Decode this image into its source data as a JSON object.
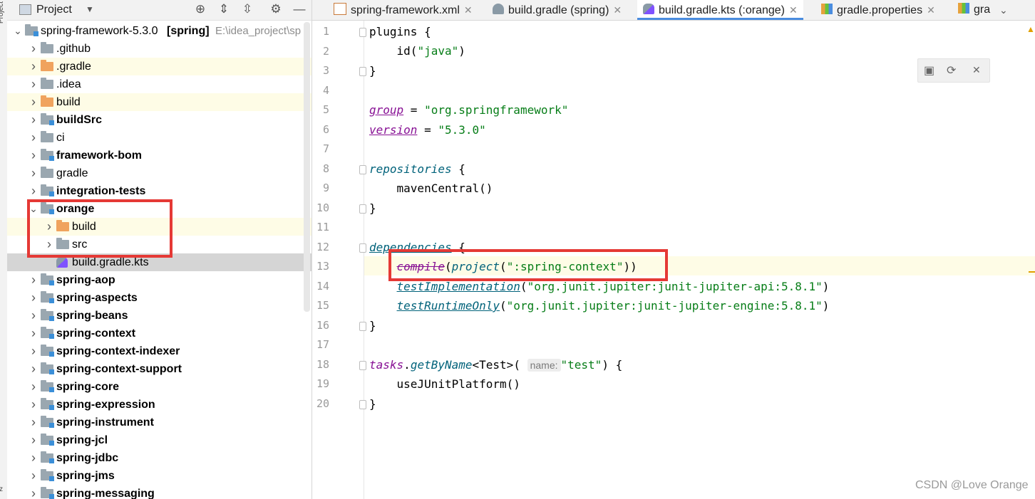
{
  "edge_strip": {
    "label_top": "Project",
    "label_bottom": "z"
  },
  "project_panel": {
    "title": "Project",
    "header_icons": [
      "target-icon",
      "expand-all-icon",
      "collapse-all-icon",
      "gear-icon",
      "minimize-icon"
    ],
    "tree": [
      {
        "label": "spring-framework-5.3.0",
        "suffix": "[spring]",
        "hint": "E:\\idea_project\\sp",
        "depth": 0,
        "expanded": true,
        "bold": false,
        "folder": "module"
      },
      {
        "label": ".github",
        "depth": 1,
        "bold": false,
        "folder": "plain"
      },
      {
        "label": ".gradle",
        "depth": 1,
        "bold": false,
        "folder": "orange",
        "highlight": true
      },
      {
        "label": ".idea",
        "depth": 1,
        "bold": false,
        "folder": "plain"
      },
      {
        "label": "build",
        "depth": 1,
        "bold": false,
        "folder": "orange",
        "highlight": true
      },
      {
        "label": "buildSrc",
        "depth": 1,
        "bold": true,
        "folder": "module"
      },
      {
        "label": "ci",
        "depth": 1,
        "bold": false,
        "folder": "plain"
      },
      {
        "label": "framework-bom",
        "depth": 1,
        "bold": true,
        "folder": "module"
      },
      {
        "label": "gradle",
        "depth": 1,
        "bold": false,
        "folder": "plain"
      },
      {
        "label": "integration-tests",
        "depth": 1,
        "bold": true,
        "folder": "module"
      },
      {
        "label": "orange",
        "depth": 1,
        "bold": true,
        "folder": "module",
        "expanded": true
      },
      {
        "label": "build",
        "depth": 2,
        "bold": false,
        "folder": "orange",
        "highlight": true
      },
      {
        "label": "src",
        "depth": 2,
        "bold": false,
        "folder": "plain"
      },
      {
        "label": "build.gradle.kts",
        "depth": 2,
        "bold": false,
        "folder": "file",
        "selected": true
      },
      {
        "label": "spring-aop",
        "depth": 1,
        "bold": true,
        "folder": "module"
      },
      {
        "label": "spring-aspects",
        "depth": 1,
        "bold": true,
        "folder": "module"
      },
      {
        "label": "spring-beans",
        "depth": 1,
        "bold": true,
        "folder": "module"
      },
      {
        "label": "spring-context",
        "depth": 1,
        "bold": true,
        "folder": "module"
      },
      {
        "label": "spring-context-indexer",
        "depth": 1,
        "bold": true,
        "folder": "module"
      },
      {
        "label": "spring-context-support",
        "depth": 1,
        "bold": true,
        "folder": "module"
      },
      {
        "label": "spring-core",
        "depth": 1,
        "bold": true,
        "folder": "module"
      },
      {
        "label": "spring-expression",
        "depth": 1,
        "bold": true,
        "folder": "module"
      },
      {
        "label": "spring-instrument",
        "depth": 1,
        "bold": true,
        "folder": "module"
      },
      {
        "label": "spring-jcl",
        "depth": 1,
        "bold": true,
        "folder": "module"
      },
      {
        "label": "spring-jdbc",
        "depth": 1,
        "bold": true,
        "folder": "module"
      },
      {
        "label": "spring-jms",
        "depth": 1,
        "bold": true,
        "folder": "module"
      },
      {
        "label": "spring-messaging",
        "depth": 1,
        "bold": true,
        "folder": "module"
      }
    ]
  },
  "tabs": [
    {
      "label": "spring-framework.xml",
      "icon": "xml-file-icon",
      "active": false
    },
    {
      "label": "build.gradle (spring)",
      "icon": "gradle-elephant-icon",
      "active": false
    },
    {
      "label": "build.gradle.kts (:orange)",
      "icon": "kotlin-gradle-icon",
      "active": true
    },
    {
      "label": "gradle.properties",
      "icon": "properties-file-icon",
      "active": false
    },
    {
      "label": "gra",
      "icon": "properties-file-icon",
      "active": false
    }
  ],
  "tab_overflow_icon": "chevron-down-icon",
  "editor": {
    "line_numbers": [
      "1",
      "2",
      "3",
      "4",
      "5",
      "6",
      "7",
      "8",
      "9",
      "10",
      "11",
      "12",
      "13",
      "14",
      "15",
      "16",
      "17",
      "18",
      "19",
      "20"
    ],
    "lines": {
      "l1_plugins": "plugins",
      "l1_brace": " {",
      "l2_id": "    id(",
      "l2_str": "\"java\"",
      "l2_close": ")",
      "l3": "}",
      "l5_group": "group",
      "l5_eq": " = ",
      "l5_str": "\"org.springframework\"",
      "l6_version": "version",
      "l6_eq": " = ",
      "l6_str": "\"5.3.0\"",
      "l8_repos": "repositories",
      "l8_brace": " {",
      "l9": "    mavenCentral()",
      "l10": "}",
      "l12_deps": "dependencies",
      "l12_brace": " {",
      "l13_indent": "    ",
      "l13_compile": "compile",
      "l13_open": "(",
      "l13_project": "project",
      "l13_open2": "(",
      "l13_str": "\":spring-context\"",
      "l13_close": "))",
      "l14_indent": "    ",
      "l14_fn": "testImplementation",
      "l14_open": "(",
      "l14_str": "\"org.junit.jupiter:junit-jupiter-api:5.8.1\"",
      "l14_close": ")",
      "l15_indent": "    ",
      "l15_fn": "testRuntimeOnly",
      "l15_open": "(",
      "l15_str": "\"org.junit.jupiter:junit-jupiter-engine:5.8.1\"",
      "l15_close": ")",
      "l16": "}",
      "l18_tasks": "tasks",
      "l18_dot": ".",
      "l18_fn": "getByName",
      "l18_generic": "<Test>(",
      "l18_hint": "name:",
      "l18_str": "\"test\"",
      "l18_close": ") {",
      "l19": "    useJUnitPlatform()",
      "l20": "}"
    }
  },
  "gradle_popup": {
    "icons": [
      "load-gradle-changes-icon",
      "sync-gradle-icon",
      "close-icon"
    ],
    "close_glyph": "✕"
  },
  "watermark": "CSDN @Love Orange",
  "colors": {
    "highlight_box": "#e53935",
    "active_tab_underline": "#4a8de0",
    "string": "#067d17",
    "property": "#871094",
    "function": "#00627a"
  }
}
